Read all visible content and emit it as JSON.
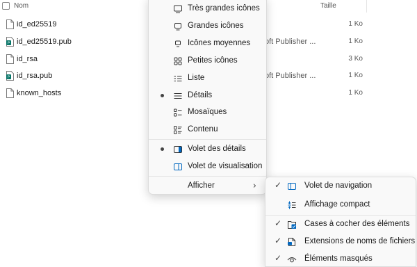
{
  "file_list": {
    "header": {
      "name": "Nom",
      "size": "Taille"
    },
    "rows": [
      {
        "name": "id_ed25519",
        "type": "",
        "size": "1 Ko",
        "icon": "file-icon"
      },
      {
        "name": "id_ed25519.pub",
        "type": "oft Publisher ...",
        "size": "1 Ko",
        "icon": "publisher-file-icon"
      },
      {
        "name": "id_rsa",
        "type": "",
        "size": "3 Ko",
        "icon": "file-icon"
      },
      {
        "name": "id_rsa.pub",
        "type": "oft Publisher ...",
        "size": "1 Ko",
        "icon": "publisher-file-icon"
      },
      {
        "name": "known_hosts",
        "type": "",
        "size": "1 Ko",
        "icon": "file-icon"
      }
    ]
  },
  "view_menu": {
    "items": [
      {
        "label": "Très grandes icônes",
        "icon": "monitor-large-icon",
        "selected": false
      },
      {
        "label": "Grandes icônes",
        "icon": "monitor-icon",
        "selected": false
      },
      {
        "label": "Icônes moyennes",
        "icon": "monitor-small-icon",
        "selected": false
      },
      {
        "label": "Petites icônes",
        "icon": "small-icons-grid-icon",
        "selected": false
      },
      {
        "label": "Liste",
        "icon": "list-icon",
        "selected": false
      },
      {
        "label": "Détails",
        "icon": "details-icon",
        "selected": true
      },
      {
        "label": "Mosaïques",
        "icon": "tiles-icon",
        "selected": false
      },
      {
        "label": "Contenu",
        "icon": "content-icon",
        "selected": false
      },
      {
        "label": "Volet des détails",
        "icon": "details-pane-icon",
        "selected": true
      },
      {
        "label": "Volet de visualisation",
        "icon": "preview-pane-icon",
        "selected": false
      },
      {
        "label": "Afficher",
        "icon": "",
        "selected": false,
        "submenu": true
      }
    ]
  },
  "show_submenu": {
    "items": [
      {
        "label": "Volet de navigation",
        "icon": "navigation-pane-icon",
        "checked": true
      },
      {
        "label": "Affichage compact",
        "icon": "compact-view-icon",
        "checked": false
      },
      {
        "label": "Cases à cocher des éléments",
        "icon": "item-checkbox-icon",
        "checked": true
      },
      {
        "label": "Extensions de noms de fichiers",
        "icon": "file-extension-icon",
        "checked": true
      },
      {
        "label": "Éléments masqués",
        "icon": "eye-icon",
        "checked": true
      }
    ]
  },
  "colors": {
    "accent": "#0067c0",
    "menu_bg": "#f9f9f9"
  }
}
